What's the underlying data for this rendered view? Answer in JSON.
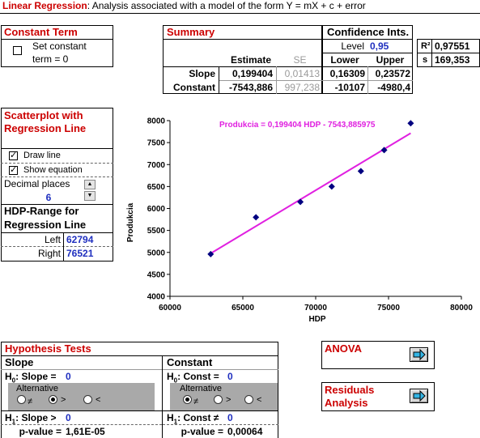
{
  "title": {
    "lead": "Linear Regression",
    "rest": ": Analysis associated with a model of the form Y = mX + c + error"
  },
  "constant_term": {
    "header": "Constant Term",
    "checkbox_line1": "Set constant",
    "checkbox_line2": "term = 0",
    "checked": false
  },
  "summary": {
    "header": "Summary",
    "col_estimate": "Estimate",
    "col_se": "SE",
    "rows": [
      {
        "label": "Slope",
        "estimate": "0,199404",
        "se": "0,01413",
        "lower": "0,16309",
        "upper": "0,23572"
      },
      {
        "label": "Constant",
        "estimate": "-7543,886",
        "se": "997,238",
        "lower": "-10107",
        "upper": "-4980,4"
      }
    ]
  },
  "confidence": {
    "header": "Confidence Ints.",
    "level_label": "Level",
    "level_value": "0,95",
    "col_lower": "Lower",
    "col_upper": "Upper"
  },
  "fit_stats": {
    "r2_label": "R²",
    "r2_value": "0,97551",
    "s_label": "s",
    "s_value": "169,353"
  },
  "scatter_panel": {
    "header_line1": "Scatterplot with",
    "header_line2": "Regression Line",
    "draw_line_label": "Draw line",
    "draw_line_checked": true,
    "show_equation_label": "Show equation",
    "show_equation_checked": true,
    "decimal_label": "Decimal places",
    "decimal_value": "6",
    "range_header_line1": "HDP-Range for",
    "range_header_line2": "Regression Line",
    "left_label": "Left",
    "left_value": "62794",
    "right_label": "Right",
    "right_value": "76521"
  },
  "chart_data": {
    "type": "scatter",
    "title": "",
    "xlabel": "HDP",
    "ylabel": "Produkcia",
    "xlim": [
      60000,
      80000
    ],
    "ylim": [
      4000,
      8000
    ],
    "xticks": [
      "60000",
      "65000",
      "70000",
      "75000",
      "80000"
    ],
    "yticks": [
      "4000",
      "4500",
      "5000",
      "5500",
      "6000",
      "6500",
      "7000",
      "7500",
      "8000"
    ],
    "points": [
      {
        "x": 62794,
        "y": 4960
      },
      {
        "x": 65900,
        "y": 5800
      },
      {
        "x": 68950,
        "y": 6150
      },
      {
        "x": 71100,
        "y": 6500
      },
      {
        "x": 73100,
        "y": 6850
      },
      {
        "x": 74700,
        "y": 7330
      },
      {
        "x": 76521,
        "y": 7940
      }
    ],
    "regression": {
      "slope": 0.199404,
      "intercept": -7543.885975,
      "x_from": 62794,
      "x_to": 76521
    },
    "equation_text": "Produkcia = 0,199404 HDP  - 7543,885975",
    "colors": {
      "points": "#000080",
      "line": "#e020e0",
      "equation": "#e020e0"
    },
    "grid": false
  },
  "hypothesis": {
    "header": "Hypothesis Tests",
    "slope": {
      "title": "Slope",
      "h0_prefix": "H",
      "h0_sub": "0",
      "h0_text": ": Slope =",
      "h0_value": "0",
      "alt_label": "Alternative",
      "opt_ne": "≠",
      "opt_gt": ">",
      "opt_lt": "<",
      "selected": "gt",
      "h1_prefix": "H",
      "h1_sub": "1",
      "h1_text": ": Slope >",
      "h1_value": "0",
      "pvalue_label": "p-value =",
      "pvalue": "1,61E-05"
    },
    "constant": {
      "title": "Constant",
      "h0_prefix": "H",
      "h0_sub": "0",
      "h0_text": ": Const =",
      "h0_value": "0",
      "alt_label": "Alternative",
      "opt_ne": "≠",
      "opt_gt": ">",
      "opt_lt": "<",
      "selected": "ne",
      "h1_prefix": "H",
      "h1_sub": "1",
      "h1_text": ": Const ≠",
      "h1_value": "0",
      "pvalue_label": "p-value =",
      "pvalue": "0,00064"
    }
  },
  "anova": {
    "label": "ANOVA",
    "icon": "arrow-right-icon"
  },
  "residuals": {
    "label_line1": "Residuals",
    "label_line2": "Analysis",
    "icon": "arrow-right-icon"
  }
}
